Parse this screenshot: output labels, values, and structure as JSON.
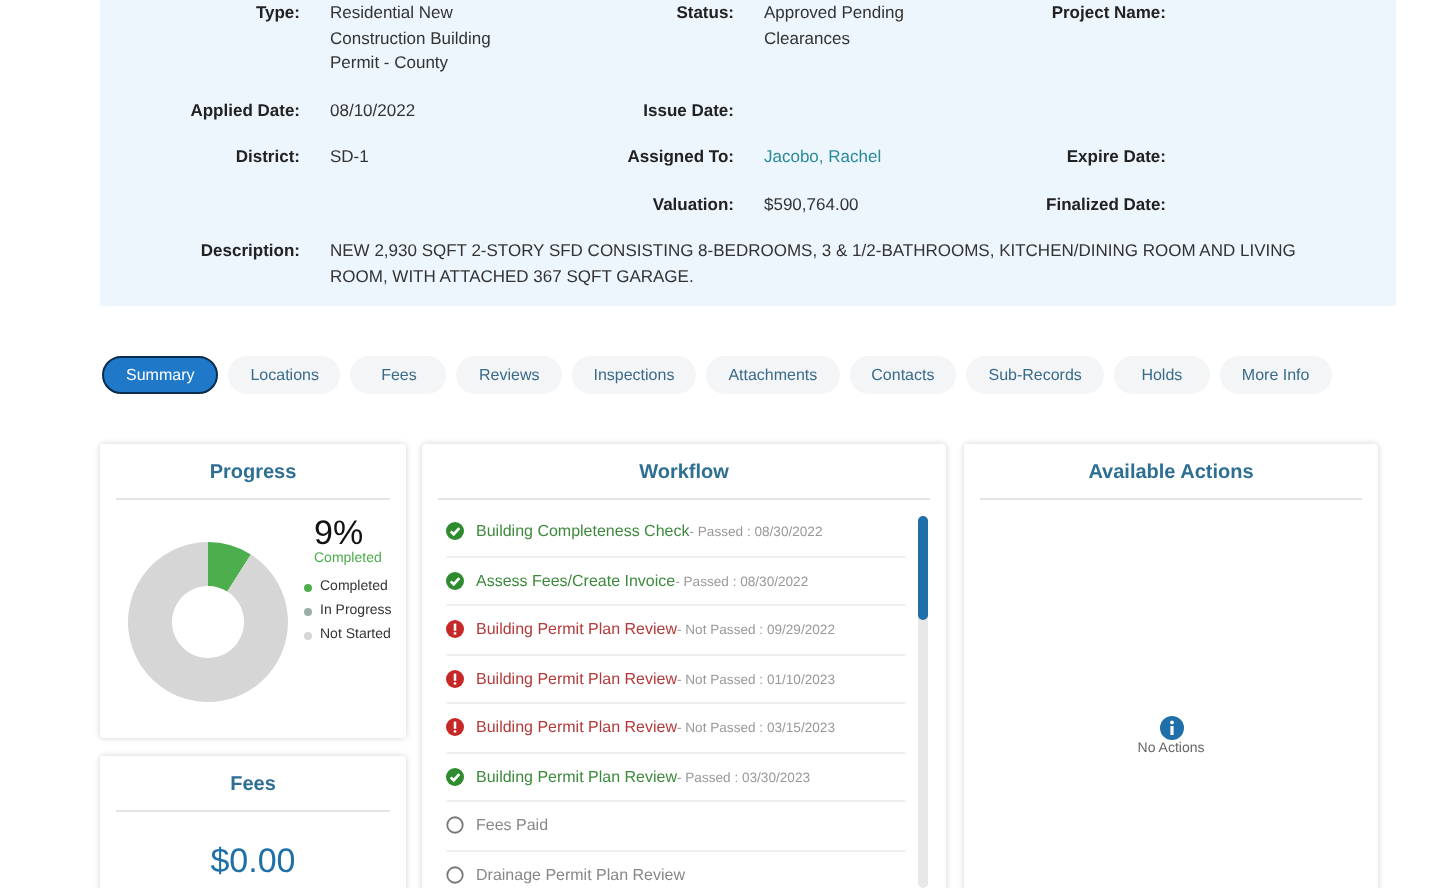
{
  "details": {
    "rows": [
      [
        {
          "label": "Type:",
          "value": "Residential New Construction Building Permit - County"
        },
        {
          "label": "Status:",
          "value": "Approved Pending Clearances"
        },
        {
          "label": "Project Name:"
        }
      ],
      [
        {
          "label": "Applied Date:",
          "value": "08/10/2022"
        },
        {
          "label": "Issue Date:"
        },
        {}
      ],
      [
        {
          "label": "District:",
          "value": "SD-1"
        },
        {
          "label": "Assigned To:",
          "value": "Jacobo, Rachel",
          "link": true
        },
        {
          "label": "Expire Date:"
        }
      ],
      [
        {},
        {
          "label": "Valuation:",
          "value": "$590,764.00"
        },
        {
          "label": "Finalized Date:"
        }
      ]
    ],
    "description": {
      "label": "Description:",
      "value": "NEW 2,930 SQFT 2-STORY SFD CONSISTING 8-BEDROOMS, 3 & 1/2-BATHROOMS, KITCHEN/DINING ROOM AND LIVING ROOM, WITH ATTACHED 367 SQFT GARAGE."
    }
  },
  "tabs": [
    {
      "label": "Summary",
      "selected": true
    },
    {
      "label": "Locations",
      "selected": false
    },
    {
      "label": "Fees",
      "selected": false
    },
    {
      "label": "Reviews",
      "selected": false
    },
    {
      "label": "Inspections",
      "selected": false
    },
    {
      "label": "Attachments",
      "selected": false
    },
    {
      "label": "Contacts",
      "selected": false
    },
    {
      "label": "Sub-Records",
      "selected": false
    },
    {
      "label": "Holds",
      "selected": false
    },
    {
      "label": "More Info",
      "selected": false
    }
  ],
  "progress": {
    "title": "Progress",
    "chart_data": {
      "type": "donut",
      "categories": [
        "Completed",
        "In Progress",
        "Not Started"
      ],
      "values": [
        9,
        0,
        91
      ]
    },
    "percent": "9%",
    "caption": "Completed",
    "legend": [
      {
        "color": "#4cae4c"
      },
      {
        "color": "#9ab0a8"
      },
      {
        "color": "#d6d6d6"
      }
    ]
  },
  "fees": {
    "title": "Fees",
    "amount": "$0.00"
  },
  "workflow": {
    "title": "Workflow",
    "items": [
      {
        "kind": "passed",
        "name": "Building Completeness Check",
        "status": "- Passed : 08/30/2022"
      },
      {
        "kind": "passed",
        "name": "Assess Fees/Create Invoice",
        "status": "- Passed : 08/30/2022"
      },
      {
        "kind": "failed",
        "name": "Building Permit Plan Review",
        "status": "- Not Passed : 09/29/2022"
      },
      {
        "kind": "failed",
        "name": "Building Permit Plan Review",
        "status": "- Not Passed : 01/10/2023"
      },
      {
        "kind": "failed",
        "name": "Building Permit Plan Review",
        "status": "- Not Passed : 03/15/2023"
      },
      {
        "kind": "passed",
        "name": "Building Permit Plan Review",
        "status": "- Passed : 03/30/2023"
      },
      {
        "kind": "pending",
        "name": "Fees Paid"
      },
      {
        "kind": "pending",
        "name": "Drainage Permit Plan Review"
      }
    ]
  },
  "actions": {
    "title": "Available Actions",
    "empty": "No Actions"
  }
}
